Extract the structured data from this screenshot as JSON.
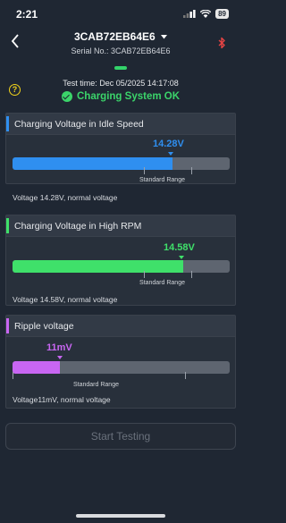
{
  "status_bar": {
    "time": "2:21",
    "battery": "89"
  },
  "header": {
    "device_name": "3CAB72EB64E6",
    "serial": "Serial No.: 3CAB72EB64E6"
  },
  "summary": {
    "test_time": "Test time: Dec 05/2025 14:17:08",
    "status": "Charging System OK"
  },
  "cards": [
    {
      "title": "Charging Voltage in Idle Speed",
      "value": "14.28V",
      "fill_fraction": 0.735,
      "range_label": "Standard Range",
      "description": "Voltage 14.28V, normal voltage",
      "color": "#2f8ff0"
    },
    {
      "title": "Charging Voltage in High RPM",
      "value": "14.58V",
      "fill_fraction": 0.785,
      "range_label": "Standard Range",
      "description": "Voltage 14.58V, normal voltage",
      "color": "#3fe06a"
    },
    {
      "title": "Ripple voltage",
      "value": "11mV",
      "fill_fraction": 0.22,
      "range_label": "Standard Range",
      "description": "Voltage11mV, normal voltage",
      "color": "#c866f2"
    }
  ],
  "actions": {
    "start": "Start Testing"
  },
  "icons": {
    "back": "chevron-left-icon",
    "dropdown": "caret-down-icon",
    "bluetooth": "bluetooth-icon",
    "help": "question-icon",
    "status": "check-circle-icon"
  },
  "colors": {
    "ok": "#3bd46a",
    "background": "#1f2733"
  }
}
